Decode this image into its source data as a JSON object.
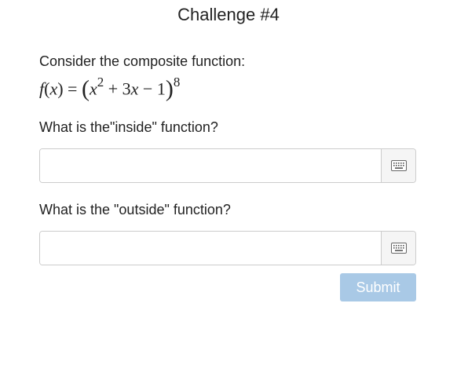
{
  "challenge": {
    "title": "Challenge #4",
    "intro": "Consider the composite function:",
    "formula": {
      "f": "f",
      "open_paren": "(",
      "x": "x",
      "close_paren": ")",
      "equals": " = ",
      "outer_open": "(",
      "inner_x": "x",
      "inner_exp": "2",
      "inner_rest": " + 3",
      "inner_x2": "x",
      "inner_tail": " − 1",
      "outer_close": ")",
      "outer_exp": "8"
    }
  },
  "inside_question": {
    "label": "What is the\"inside\" function?",
    "value": "",
    "placeholder": ""
  },
  "outside_question": {
    "label": "What is the \"outside\" function?",
    "value": "",
    "placeholder": ""
  },
  "submit": {
    "label": "Submit"
  },
  "colors": {
    "submit_disabled": "#a9c9e6",
    "border": "#cccccc",
    "keyboard_bg": "#f5f5f5"
  }
}
